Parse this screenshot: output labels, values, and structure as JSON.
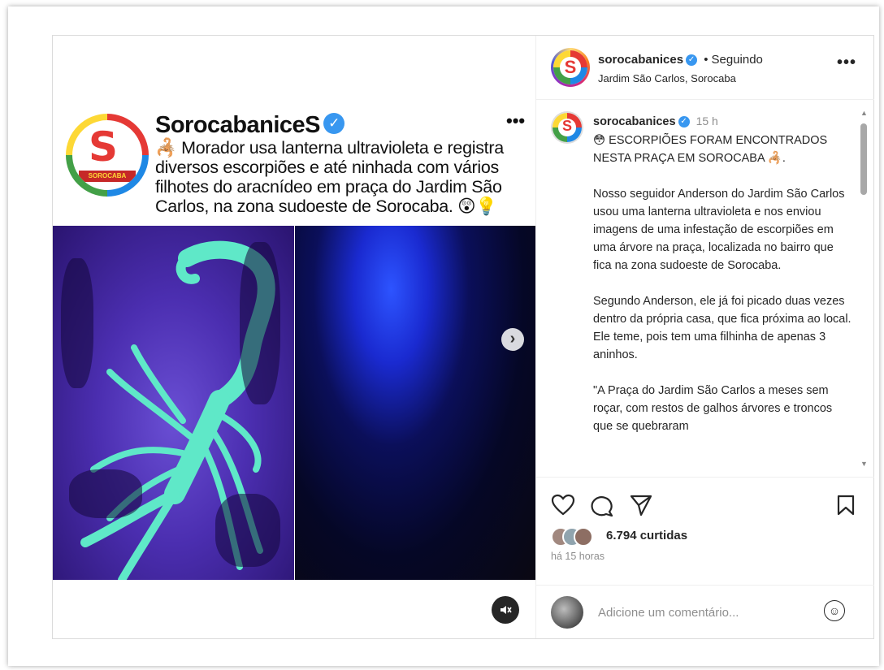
{
  "media": {
    "brand_name": "SorocabaniceS",
    "logo_banner": "SOROCABA",
    "logo_letter": "S",
    "headline": "🦂 Morador usa lanterna ultravioleta e registra diversos escorpiões e até ninhada com vários filhotes do aracnídeo em praça do Jardim São Carlos, na zona sudoeste de Sorocaba. 😲💡",
    "more_icon": "•••",
    "next_icon": "chevron-right-icon",
    "mute_icon": "speaker-muted-icon"
  },
  "header": {
    "username": "sorocabanices",
    "separator": "•",
    "follow_status": "Seguindo",
    "location": "Jardim São Carlos, Sorocaba",
    "more_icon": "•••"
  },
  "caption": {
    "username": "sorocabanices",
    "time": "15 h",
    "text": "😳 ESCORPIÕES FORAM ENCONTRADOS NESTA PRAÇA EM SOROCABA 🦂.\n\nNosso seguidor Anderson do Jardim São Carlos usou uma lanterna ultravioleta e nos enviou imagens de uma infestação de escorpiões em uma árvore na praça, localizada no bairro que fica na zona sudoeste de Sorocaba.\n\nSegundo Anderson, ele já foi picado duas vezes dentro da própria casa, que fica próxima ao local. Ele teme, pois tem uma filhinha de apenas 3 aninhos.\n\n\"A Praça do Jardim São Carlos a meses sem roçar, com restos de galhos árvores e troncos que se quebraram"
  },
  "actions": {
    "likes": "6.794 curtidas",
    "posted": "há 15 horas"
  },
  "comment": {
    "placeholder": "Adicione um comentário...",
    "emoji_glyph": "☺"
  },
  "colors": {
    "verified": "#3897f0",
    "uv_purple": "#4b2eb0",
    "scorpion_glow": "#5fe8c8"
  }
}
